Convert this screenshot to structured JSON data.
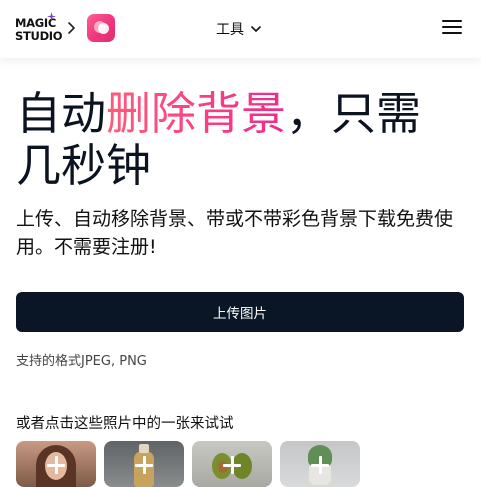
{
  "header": {
    "logo_line1": "MAGIC",
    "logo_line2": "STUDIO",
    "tools_label": "工具"
  },
  "hero": {
    "title_prefix": "自动",
    "title_highlight": "删除背景",
    "title_suffix": "，只需几秒钟",
    "subtitle": "上传、自动移除背景、带或不带彩色背景下载免费使用。不需要注册!"
  },
  "upload": {
    "button_label": "上传图片",
    "formats": "支持的格式JPEG, PNG"
  },
  "samples": {
    "label": "或者点击这些照片中的一张来试试"
  },
  "colors": {
    "accent_gradient_start": "#ff5c7c",
    "accent_gradient_end": "#f02a8a",
    "button_bg": "#0a1525"
  }
}
